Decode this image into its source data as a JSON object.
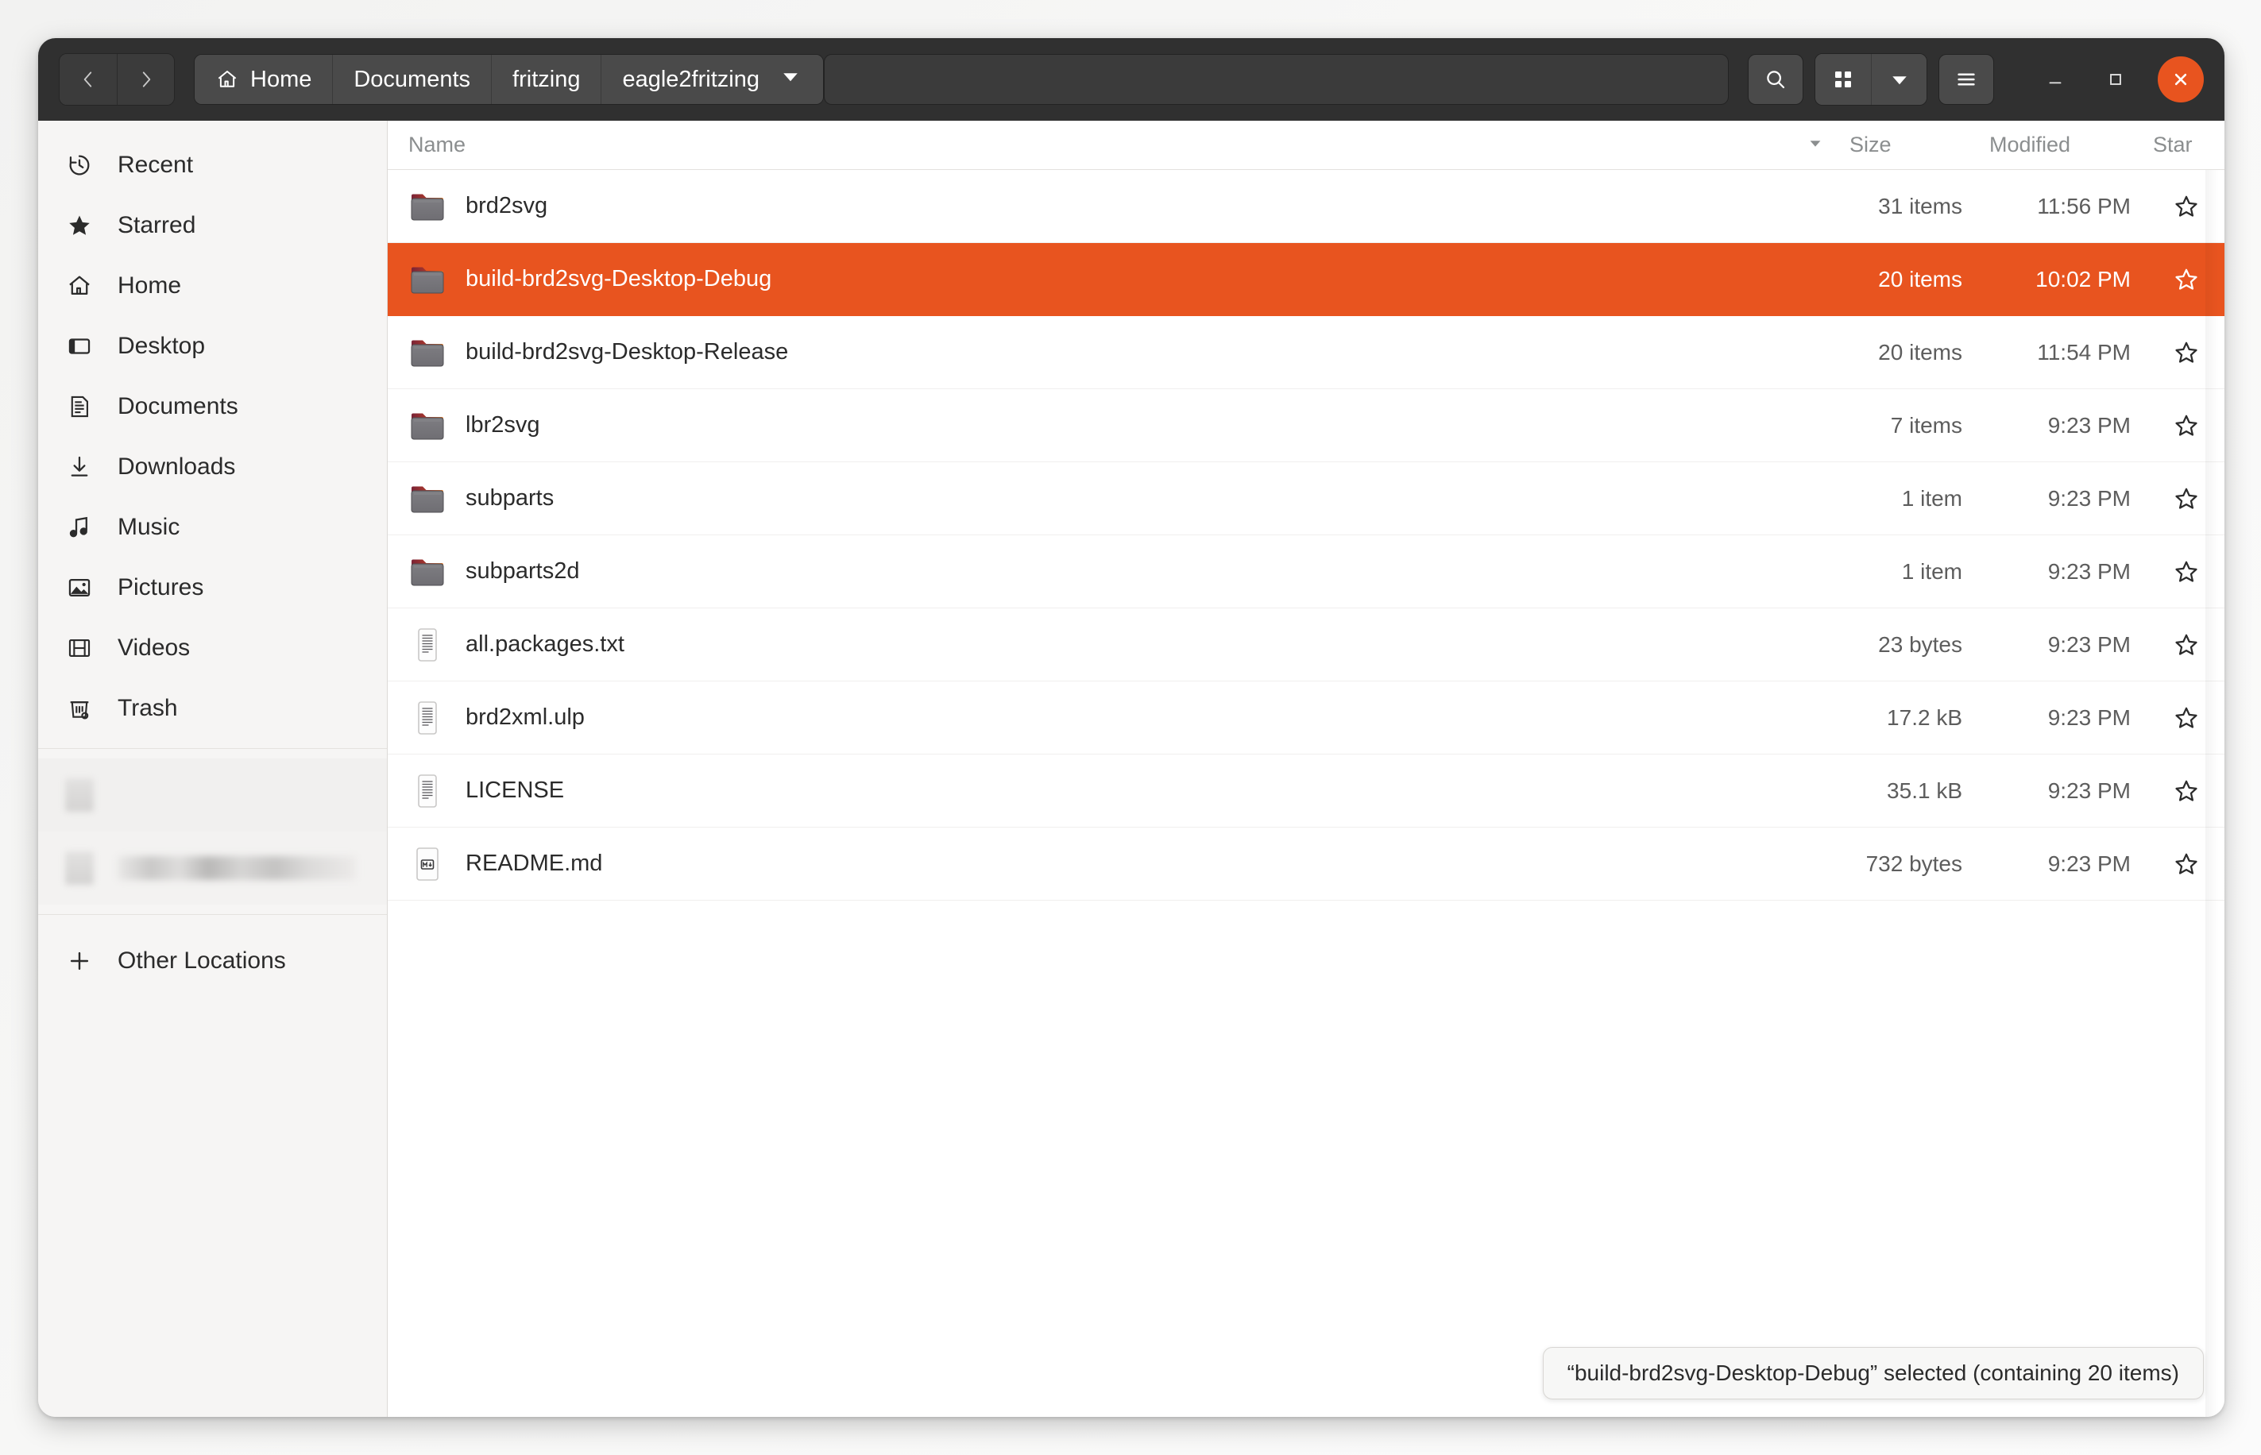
{
  "window": {
    "nav": {
      "back_label": "Back",
      "forward_label": "Forward"
    }
  },
  "breadcrumbs": [
    {
      "label": "Home",
      "icon": "home-icon"
    },
    {
      "label": "Documents",
      "icon": null
    },
    {
      "label": "fritzing",
      "icon": null
    },
    {
      "label": "eagle2fritzing",
      "icon": null
    }
  ],
  "toolbar": {
    "search_label": "Search",
    "view_grid_label": "Grid view",
    "view_options_label": "View options",
    "menu_label": "Main menu",
    "minimize_label": "Minimize",
    "maximize_label": "Maximize",
    "close_label": "Close"
  },
  "sidebar": {
    "items": [
      {
        "label": "Recent",
        "icon": "clock-icon"
      },
      {
        "label": "Starred",
        "icon": "star-icon"
      },
      {
        "label": "Home",
        "icon": "home-icon"
      },
      {
        "label": "Desktop",
        "icon": "desktop-icon"
      },
      {
        "label": "Documents",
        "icon": "document-icon"
      },
      {
        "label": "Downloads",
        "icon": "download-icon"
      },
      {
        "label": "Music",
        "icon": "music-note-icon"
      },
      {
        "label": "Pictures",
        "icon": "picture-icon"
      },
      {
        "label": "Videos",
        "icon": "film-icon"
      },
      {
        "label": "Trash",
        "icon": "trash-icon"
      }
    ],
    "redacted_items": [
      {
        "label": ""
      },
      {
        "label": ""
      }
    ],
    "other_locations": {
      "label": "Other Locations",
      "icon": "plus-icon"
    }
  },
  "columns": {
    "name": "Name",
    "size": "Size",
    "modified": "Modified",
    "star": "Star",
    "sort_direction": "descending"
  },
  "files": [
    {
      "name": "brd2svg",
      "type": "folder",
      "size": "31 items",
      "modified": "11:56 PM",
      "starred": false,
      "selected": false
    },
    {
      "name": "build-brd2svg-Desktop-Debug",
      "type": "folder",
      "size": "20 items",
      "modified": "10:02 PM",
      "starred": false,
      "selected": true
    },
    {
      "name": "build-brd2svg-Desktop-Release",
      "type": "folder",
      "size": "20 items",
      "modified": "11:54 PM",
      "starred": false,
      "selected": false
    },
    {
      "name": "lbr2svg",
      "type": "folder",
      "size": "7 items",
      "modified": "9:23 PM",
      "starred": false,
      "selected": false
    },
    {
      "name": "subparts",
      "type": "folder",
      "size": "1 item",
      "modified": "9:23 PM",
      "starred": false,
      "selected": false
    },
    {
      "name": "subparts2d",
      "type": "folder",
      "size": "1 item",
      "modified": "9:23 PM",
      "starred": false,
      "selected": false
    },
    {
      "name": "all.packages.txt",
      "type": "text",
      "size": "23 bytes",
      "modified": "9:23 PM",
      "starred": false,
      "selected": false
    },
    {
      "name": "brd2xml.ulp",
      "type": "text",
      "size": "17.2 kB",
      "modified": "9:23 PM",
      "starred": false,
      "selected": false
    },
    {
      "name": "LICENSE",
      "type": "text",
      "size": "35.1 kB",
      "modified": "9:23 PM",
      "starred": false,
      "selected": false
    },
    {
      "name": "README.md",
      "type": "markdown",
      "size": "732 bytes",
      "modified": "9:23 PM",
      "starred": false,
      "selected": false
    }
  ],
  "status": {
    "text": "“build-brd2svg-Desktop-Debug” selected  (containing 20 items)"
  },
  "colors": {
    "accent": "#e8541f",
    "headerbar": "#303030",
    "sidebar": "#f6f5f4",
    "window": "#ffffff"
  }
}
